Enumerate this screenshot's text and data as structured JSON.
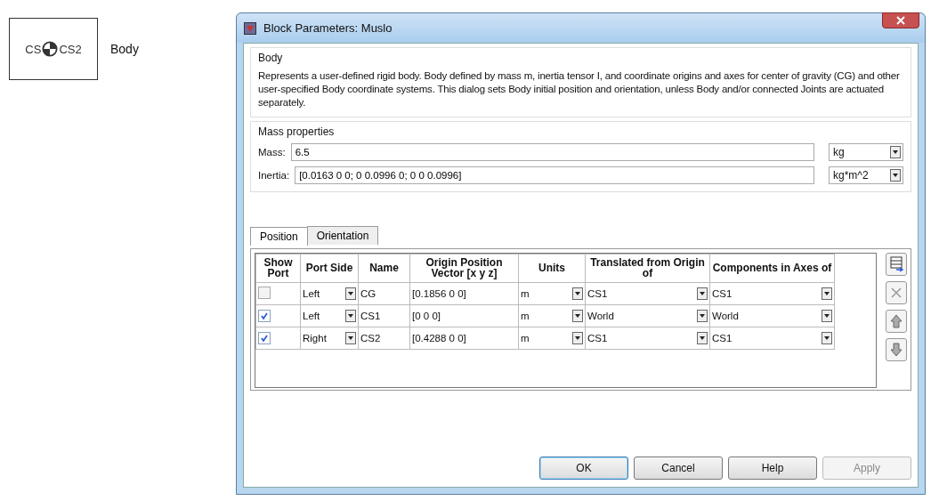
{
  "block": {
    "port_left": "CS",
    "port_right": "CS2",
    "name": "Body"
  },
  "window": {
    "title": "Block Parameters: Muslo"
  },
  "description": {
    "title": "Body",
    "text": "Represents a user-defined rigid body. Body defined by mass m, inertia tensor I, and coordinate origins and axes for center of gravity (CG) and other user-specified Body coordinate systems. This dialog sets Body initial position and orientation, unless Body and/or connected Joints are actuated separately."
  },
  "mass_properties": {
    "title": "Mass properties",
    "fields": [
      {
        "label": "Mass:",
        "value": "6.5",
        "unit": "kg"
      },
      {
        "label": "Inertia:",
        "value": "[0.0163 0 0; 0 0.0996 0; 0 0 0.0996]",
        "unit": "kg*m^2"
      }
    ]
  },
  "tabs": [
    {
      "label": "Position",
      "selected": true
    },
    {
      "label": "Orientation",
      "selected": false
    }
  ],
  "table": {
    "columns": [
      "Show Port",
      "Port Side",
      "Name",
      "Origin Position Vector [x y z]",
      "Units",
      "Translated from Origin of",
      "Components in Axes of"
    ],
    "rows": [
      {
        "show_port": false,
        "port_side": "Left",
        "name": "CG",
        "origin": "[0.1856 0 0]",
        "units": "m",
        "translated_from": "CS1",
        "components_in": "CS1"
      },
      {
        "show_port": true,
        "port_side": "Left",
        "name": "CS1",
        "origin": "[0 0 0]",
        "units": "m",
        "translated_from": "World",
        "components_in": "World"
      },
      {
        "show_port": true,
        "port_side": "Right",
        "name": "CS2",
        "origin": "[0.4288 0 0]",
        "units": "m",
        "translated_from": "CS1",
        "components_in": "CS1"
      }
    ]
  },
  "buttons": [
    {
      "label": "OK",
      "disabled": false,
      "default": true
    },
    {
      "label": "Cancel",
      "disabled": false,
      "default": false
    },
    {
      "label": "Help",
      "disabled": false,
      "default": false
    },
    {
      "label": "Apply",
      "disabled": true,
      "default": false
    }
  ]
}
